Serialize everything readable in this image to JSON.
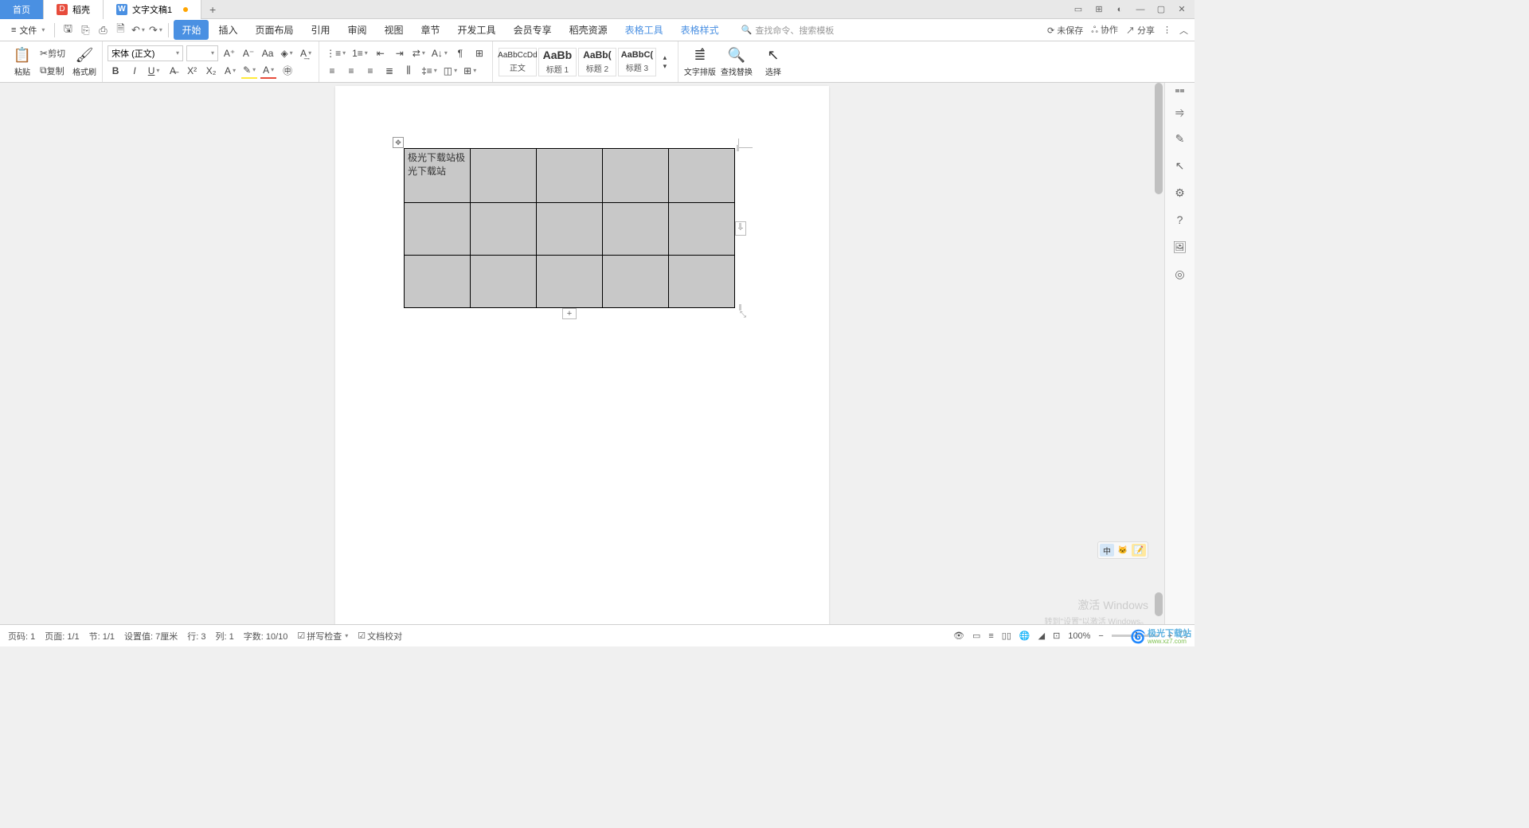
{
  "tabs": {
    "home": "首页",
    "doke": "稻壳",
    "doc": "文字文稿1"
  },
  "file_label": "文件",
  "menu": {
    "start": "开始",
    "insert": "插入",
    "layout": "页面布局",
    "ref": "引用",
    "review": "审阅",
    "view": "视图",
    "chapter": "章节",
    "dev": "开发工具",
    "member": "会员专享",
    "res": "稻壳资源",
    "tabletool": "表格工具",
    "tablestyle": "表格样式"
  },
  "search_placeholder": "查找命令、搜索模板",
  "topright": {
    "unsaved": "未保存",
    "collab": "协作",
    "share": "分享"
  },
  "clipboard": {
    "paste": "粘贴",
    "cut": "剪切",
    "copy": "复制",
    "format": "格式刷"
  },
  "font": {
    "name": "宋体 (正文)",
    "size": ""
  },
  "styles": {
    "normal_pv": "AaBbCcDd",
    "normal": "正文",
    "h1_pv": "AaBb",
    "h1": "标题 1",
    "h2_pv": "AaBb(",
    "h2": "标题 2",
    "h3_pv": "AaBbC(",
    "h3": "标题 3"
  },
  "tools": {
    "layout": "文字排版",
    "find": "查找替换",
    "select": "选择"
  },
  "table_cell": "极光下载站极光下载站",
  "watermark": {
    "l1": "激活 Windows",
    "l2": "转到\"设置\"以激活 Windows。"
  },
  "logo": "极光下载站",
  "logo_url": "www.xz7.com",
  "status": {
    "page_no": "页码: 1",
    "page": "页面: 1/1",
    "sec": "节: 1/1",
    "pos": "设置值: 7厘米",
    "row": "行: 3",
    "col": "列: 1",
    "words": "字数: 10/10",
    "spell": "拼写检查",
    "proof": "文档校对",
    "zoom": "100%"
  },
  "float": {
    "a": "中"
  }
}
